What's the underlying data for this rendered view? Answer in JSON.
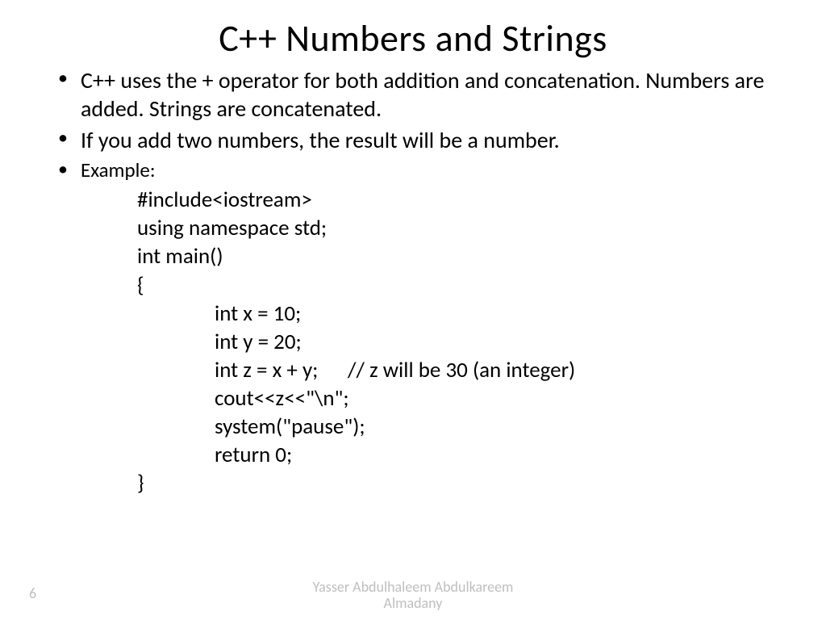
{
  "title": "C++ Numbers and Strings",
  "bullets": {
    "b1": "C++ uses the + operator for both addition and concatenation. Numbers are added. Strings are concatenated.",
    "b2": "If you add two numbers, the result will be a number.",
    "b3": "Example:"
  },
  "code": {
    "l1": "#include<iostream>",
    "l2": "using namespace std;",
    "l3": "int main()",
    "l4": "{",
    "l5": "int x = 10;",
    "l6": "int y = 20;",
    "l7": "int z = x + y;      // z will be 30 (an integer)",
    "l8": "cout<<z<<\"\\n\";",
    "l9": "system(\"pause\");",
    "l10": "return 0;",
    "l11": "}"
  },
  "page_number": "6",
  "author_line1": "Yasser Abdulhaleem Abdulkareem",
  "author_line2": "Almadany"
}
